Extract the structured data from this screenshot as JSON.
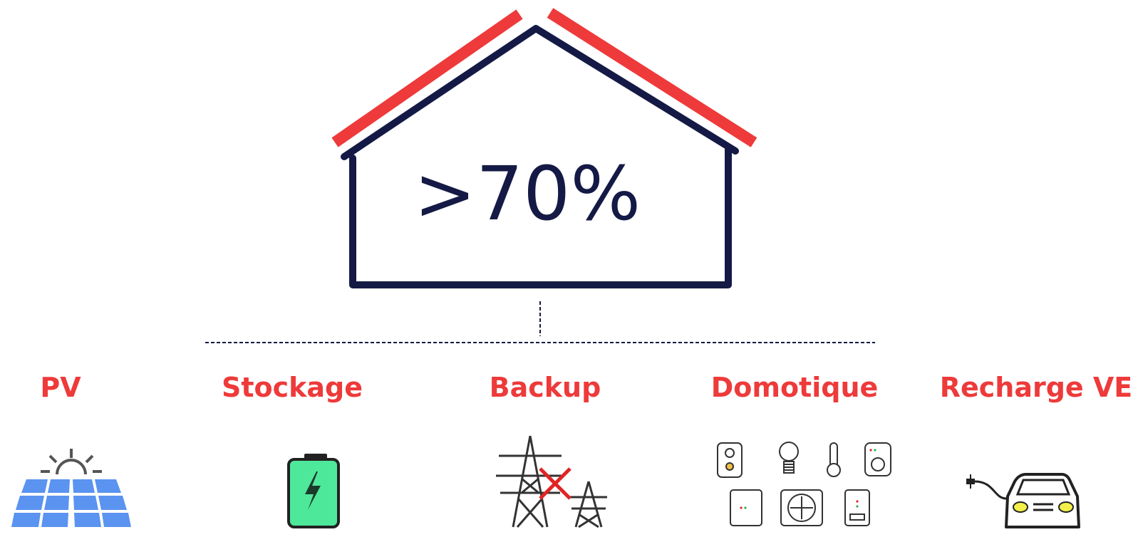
{
  "house": {
    "value": ">70%"
  },
  "features": [
    {
      "id": "pv",
      "label": "PV",
      "icon": "solar-panel-icon"
    },
    {
      "id": "stockage",
      "label": "Stockage",
      "icon": "battery-icon"
    },
    {
      "id": "backup",
      "label": "Backup",
      "icon": "power-pylon-cross-icon"
    },
    {
      "id": "domotique",
      "label": "Domotique",
      "icon": "smart-home-devices-icon"
    },
    {
      "id": "recharge-ve",
      "label": "Recharge VE",
      "icon": "electric-car-icon"
    }
  ],
  "colors": {
    "navy": "#141a45",
    "red": "#ee3a3a",
    "solar_blue": "#5b93f0",
    "battery_green": "#4ee89a",
    "yellow": "#f3f04a",
    "gray": "#555555"
  }
}
